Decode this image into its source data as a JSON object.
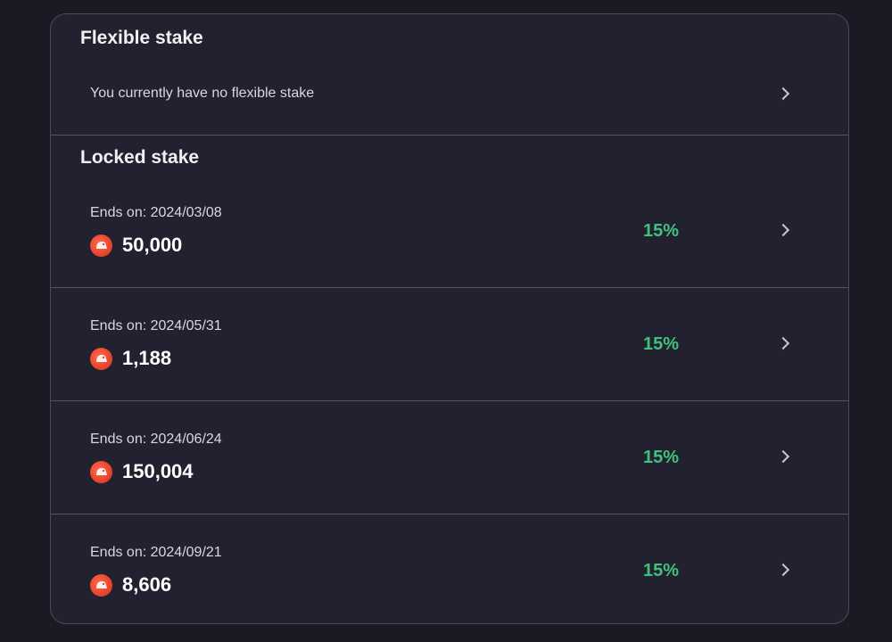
{
  "flexible": {
    "title": "Flexible stake",
    "empty_text": "You currently have no flexible stake"
  },
  "locked": {
    "title": "Locked stake",
    "items": [
      {
        "ends": "Ends on: 2024/03/08",
        "amount": "50,000",
        "apr": "15%"
      },
      {
        "ends": "Ends on: 2024/05/31",
        "amount": "1,188",
        "apr": "15%"
      },
      {
        "ends": "Ends on: 2024/06/24",
        "amount": "150,004",
        "apr": "15%"
      },
      {
        "ends": "Ends on: 2024/09/21",
        "amount": "8,606",
        "apr": "15%"
      }
    ]
  },
  "colors": {
    "background": "#1a1a25",
    "card": "#22212f",
    "border": "#4c4c58",
    "apr_green": "#3fc27a",
    "token_orange": "#e8452b"
  },
  "icons": {
    "token": "token-coin-icon",
    "chevron": "chevron-right-icon"
  }
}
